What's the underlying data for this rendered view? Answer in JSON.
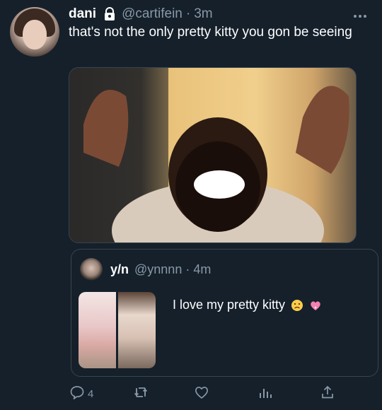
{
  "tweet": {
    "display_name": "dani",
    "handle": "@cartifein",
    "dot": "·",
    "time": "3m",
    "text": "that's not the only pretty kitty you gon be seeing"
  },
  "quote": {
    "display_name": "y/n",
    "handle": "@ynnnn",
    "dot": "·",
    "time": "4m",
    "text": "I love my pretty kitty"
  },
  "actions": {
    "reply_count": "4"
  },
  "colors": {
    "background": "#15202b",
    "muted": "#8899a6",
    "border": "#38444d"
  }
}
